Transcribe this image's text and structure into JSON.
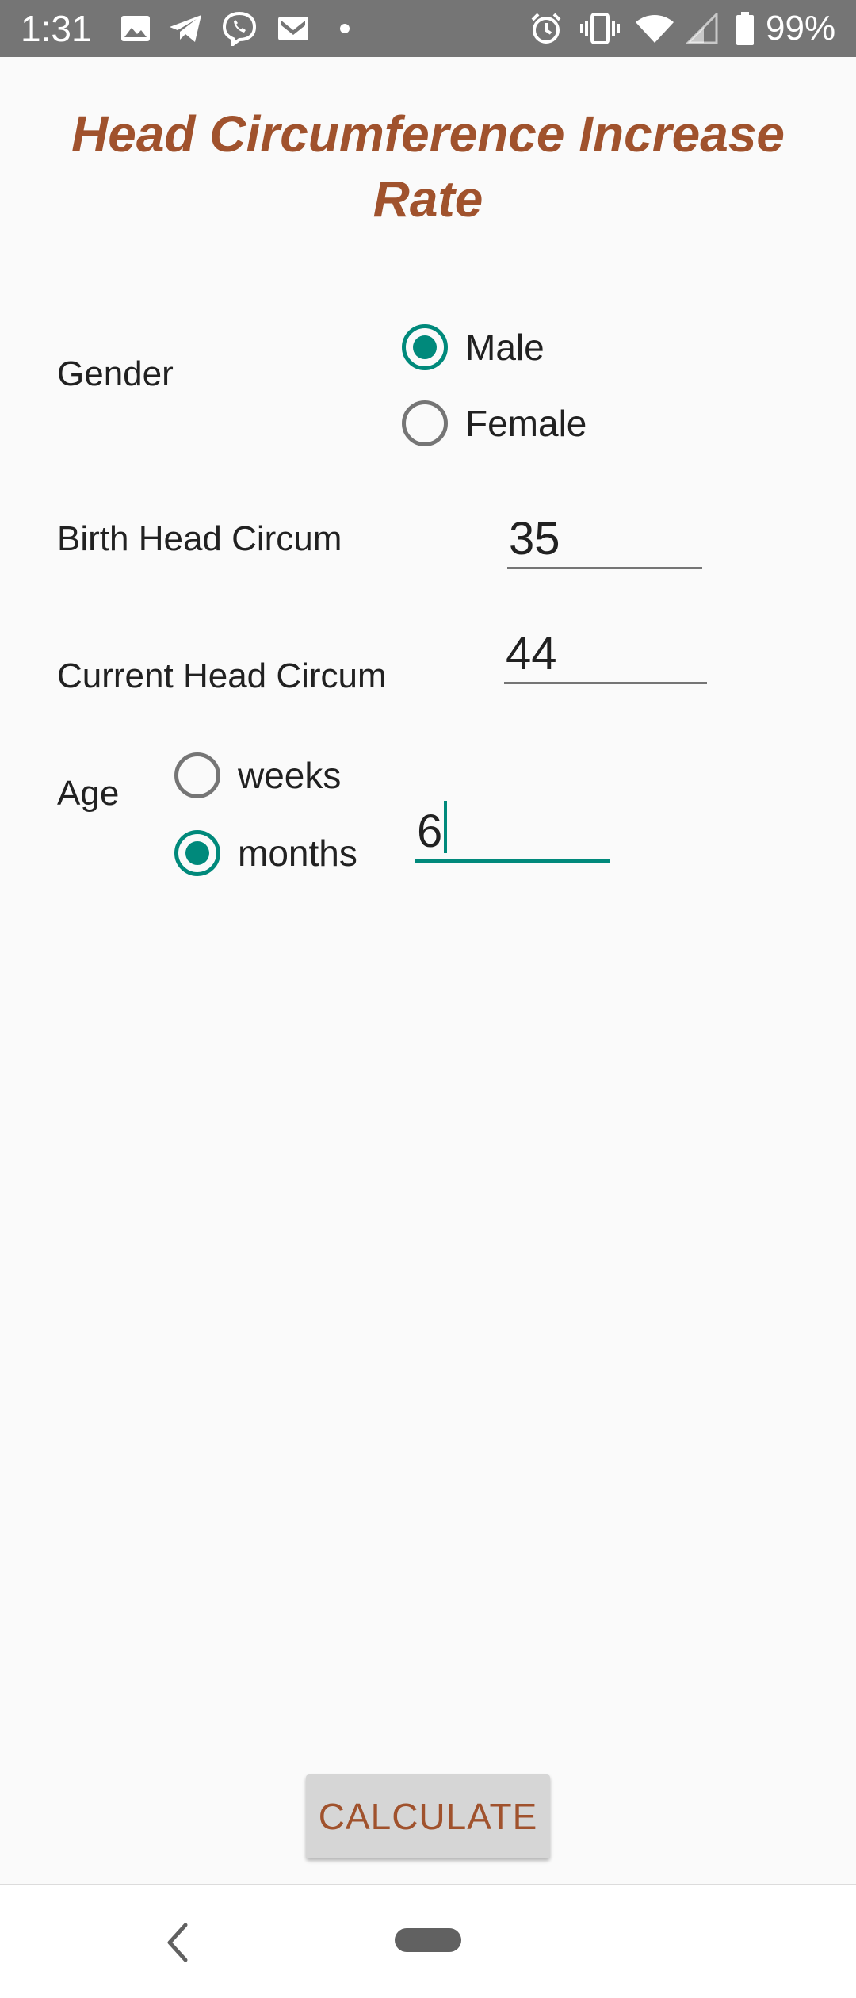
{
  "status_bar": {
    "time": "1:31",
    "battery_percent": "99%",
    "left_icons": [
      "image-icon",
      "telegram-icon",
      "viber-icon",
      "gmail-icon",
      "dot-icon"
    ],
    "right_icons": [
      "alarm-icon",
      "vibrate-icon",
      "wifi-icon",
      "signal-icon",
      "battery-icon"
    ]
  },
  "title": "Head Circumference Increase Rate",
  "gender": {
    "label": "Gender",
    "options": [
      "Male",
      "Female"
    ],
    "selected": "Male"
  },
  "birth_head": {
    "label": "Birth Head Circum",
    "value": "35"
  },
  "current_head": {
    "label": "Current Head Circum",
    "value": "44"
  },
  "age": {
    "label": "Age",
    "units": [
      "weeks",
      "months"
    ],
    "selected_unit": "months",
    "value": "6"
  },
  "calculate_label": "CALCULATE",
  "colors": {
    "accent": "#00897b",
    "title": "#a0522d",
    "button_text": "#a0522d",
    "status_bar": "#757575"
  }
}
